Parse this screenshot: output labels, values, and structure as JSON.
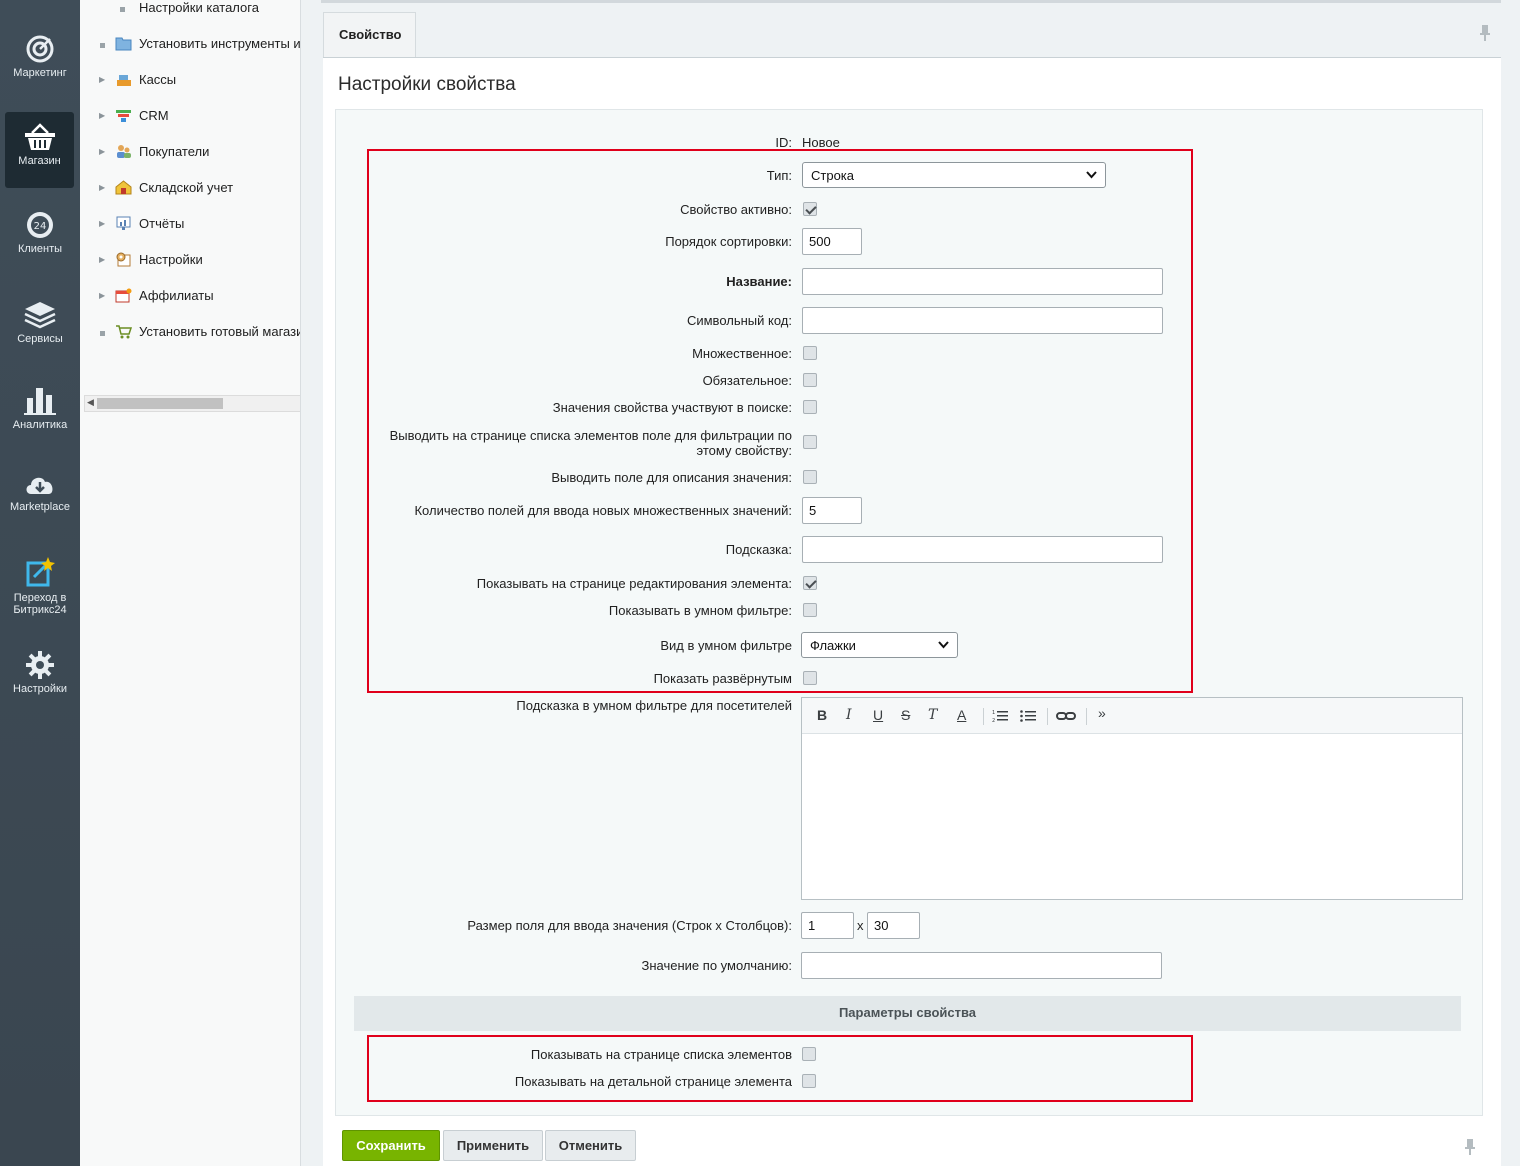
{
  "leftbar": {
    "items": [
      {
        "label": "Маркетинг",
        "icon": "target-icon"
      },
      {
        "label": "Магазин",
        "icon": "basket-icon",
        "active": true
      },
      {
        "label": "Клиенты",
        "icon": "clients-24-icon"
      },
      {
        "label": "Сервисы",
        "icon": "layers-icon"
      },
      {
        "label": "Аналитика",
        "icon": "bar-chart-icon"
      },
      {
        "label": "Marketplace",
        "icon": "cloud-download-icon"
      },
      {
        "label": "Переход в Битрикс24",
        "icon": "bitrix24-go-icon"
      },
      {
        "label": "Настройки",
        "icon": "gear-icon"
      }
    ]
  },
  "tree": {
    "items": [
      {
        "label": "Настройки каталога",
        "marker": "dot"
      },
      {
        "label": "Установить инструменты и",
        "marker": "dot",
        "icon": "folder-icon"
      },
      {
        "label": "Кассы",
        "marker": "arrow",
        "icon": "cashbox-icon"
      },
      {
        "label": "CRM",
        "marker": "arrow",
        "icon": "crm-filter-icon"
      },
      {
        "label": "Покупатели",
        "marker": "arrow",
        "icon": "customers-icon"
      },
      {
        "label": "Складской учет",
        "marker": "arrow",
        "icon": "warehouse-icon"
      },
      {
        "label": "Отчёты",
        "marker": "arrow",
        "icon": "reports-icon"
      },
      {
        "label": "Настройки",
        "marker": "arrow",
        "icon": "settings-icon"
      },
      {
        "label": "Аффилиаты",
        "marker": "arrow",
        "icon": "affiliates-icon"
      },
      {
        "label": "Установить готовый магази",
        "marker": "dot",
        "icon": "cart-icon"
      }
    ]
  },
  "tab": {
    "label": "Свойство"
  },
  "panel": {
    "title": "Настройки свойства"
  },
  "form": {
    "id_label": "ID:",
    "id_value": "Новое",
    "type_label": "Тип:",
    "type_value": "Строка",
    "active_label": "Свойство активно:",
    "active_checked": true,
    "sort_label": "Порядок сортировки:",
    "sort_value": "500",
    "name_label": "Название:",
    "name_value": "",
    "code_label": "Символьный код:",
    "code_value": "",
    "multiple_label": "Множественное:",
    "required_label": "Обязательное:",
    "search_label": "Значения свойства участвуют в поиске:",
    "filter_label": "Выводить на странице списка элементов поле для фильтрации по этому свойству:",
    "description_label": "Выводить поле для описания значения:",
    "multi_count_label": "Количество полей для ввода новых множественных значений:",
    "multi_count_value": "5",
    "hint_label": "Подсказка:",
    "hint_value": "",
    "show_edit_label": "Показывать на странице редактирования элемента:",
    "show_edit_checked": true,
    "smart_filter_label": "Показывать в умном фильтре:",
    "smart_view_label": "Вид в умном фильтре",
    "smart_view_value": "Флажки",
    "expanded_label": "Показать развёрнутым",
    "smart_hint_label": "Подсказка в умном фильтре для посетителей",
    "size_label": "Размер поля для ввода значения (Строк х Столбцов):",
    "size_rows": "1",
    "size_x": "x",
    "size_cols": "30",
    "default_label": "Значение по умолчанию:",
    "default_value": ""
  },
  "editor_toolbar": {
    "bold": "B",
    "italic": "I",
    "underline": "U",
    "strike": "S",
    "clear_format": "T",
    "font_color": "A",
    "more": "»"
  },
  "params": {
    "title": "Параметры свойства",
    "list_label": "Показывать на странице списка элементов",
    "detail_label": "Показывать на детальной странице элемента"
  },
  "buttons": {
    "save": "Сохранить",
    "apply": "Применить",
    "cancel": "Отменить"
  },
  "colors": {
    "highlight": "#e0001b",
    "save_button": "#78b400",
    "leftbar": "#3f4d58"
  }
}
